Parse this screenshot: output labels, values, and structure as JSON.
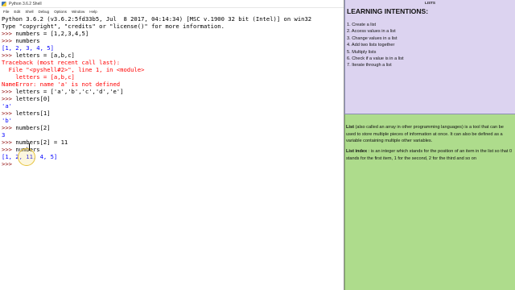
{
  "window": {
    "title": "Python 3.6.2 Shell"
  },
  "menu": [
    "File",
    "Edit",
    "Shell",
    "Debug",
    "Options",
    "Window",
    "Help"
  ],
  "shell_lines": [
    {
      "kind": "out",
      "text": "Python 3.6.2 (v3.6.2:5fd33b5, Jul  8 2017, 04:14:34) [MSC v.1900 32 bit (Intel)] on win32"
    },
    {
      "kind": "out",
      "text": "Type \"copyright\", \"credits\" or \"license()\" for more information."
    },
    {
      "kind": "prompt",
      "prompt": ">>> ",
      "text": "numbers = [1,2,3,4,5]"
    },
    {
      "kind": "prompt",
      "prompt": ">>> ",
      "text": "numbers"
    },
    {
      "kind": "output",
      "text": "[1, 2, 3, 4, 5]"
    },
    {
      "kind": "prompt",
      "prompt": ">>> ",
      "text": "letters = [a,b,c]"
    },
    {
      "kind": "error",
      "text": "Traceback (most recent call last):"
    },
    {
      "kind": "error",
      "text": "  File \"<pyshell#2>\", line 1, in <module>"
    },
    {
      "kind": "error",
      "text": "    letters = [a,b,c]"
    },
    {
      "kind": "error",
      "text": "NameError: name 'a' is not defined"
    },
    {
      "kind": "prompt",
      "prompt": ">>> ",
      "text": "letters = ['a','b','c','d','e']"
    },
    {
      "kind": "prompt",
      "prompt": ">>> ",
      "text": "letters[0]"
    },
    {
      "kind": "output",
      "text": "'a'"
    },
    {
      "kind": "prompt",
      "prompt": ">>> ",
      "text": "letters[1]"
    },
    {
      "kind": "output",
      "text": "'b'"
    },
    {
      "kind": "prompt",
      "prompt": ">>> ",
      "text": "numbers[2]"
    },
    {
      "kind": "output",
      "text": "3"
    },
    {
      "kind": "prompt",
      "prompt": ">>> ",
      "text": "numbers[2] = 11"
    },
    {
      "kind": "prompt",
      "prompt": ">>> ",
      "text": "numbers"
    },
    {
      "kind": "output",
      "text": "[1, 2, 11, 4, 5]"
    },
    {
      "kind": "prompt",
      "prompt": ">>> ",
      "text": ""
    }
  ],
  "panel": {
    "topic": "LISTS",
    "objectives_heading": "LEARNING INTENTIONS:",
    "objectives": [
      "1.  Create a list",
      "2.  Access values in a list",
      "3.  Change values in a list",
      "4.  Add two lists together",
      "5.  Multiply lists",
      "6.  Check if a value is in a list",
      "7.  Iterate through a list"
    ],
    "def_list_term": "List",
    "def_list_text": " (also called an array in other programming languages) is a tool that can be used to store multiple pieces of information at once. It can also be defined as a variable containing multiple other variables.",
    "def_index_term": "List index",
    "def_index_text": " : is an integer which stands for the position of an item in the list so that 0 stands for the first item, 1 for the second, 2 for the third and so on"
  },
  "colors": {
    "prompt": "#8b0000",
    "output": "#0000ff",
    "error": "#ff0000",
    "objectives_bg": "#dcd3f0",
    "definitions_bg": "#aedc8c"
  }
}
